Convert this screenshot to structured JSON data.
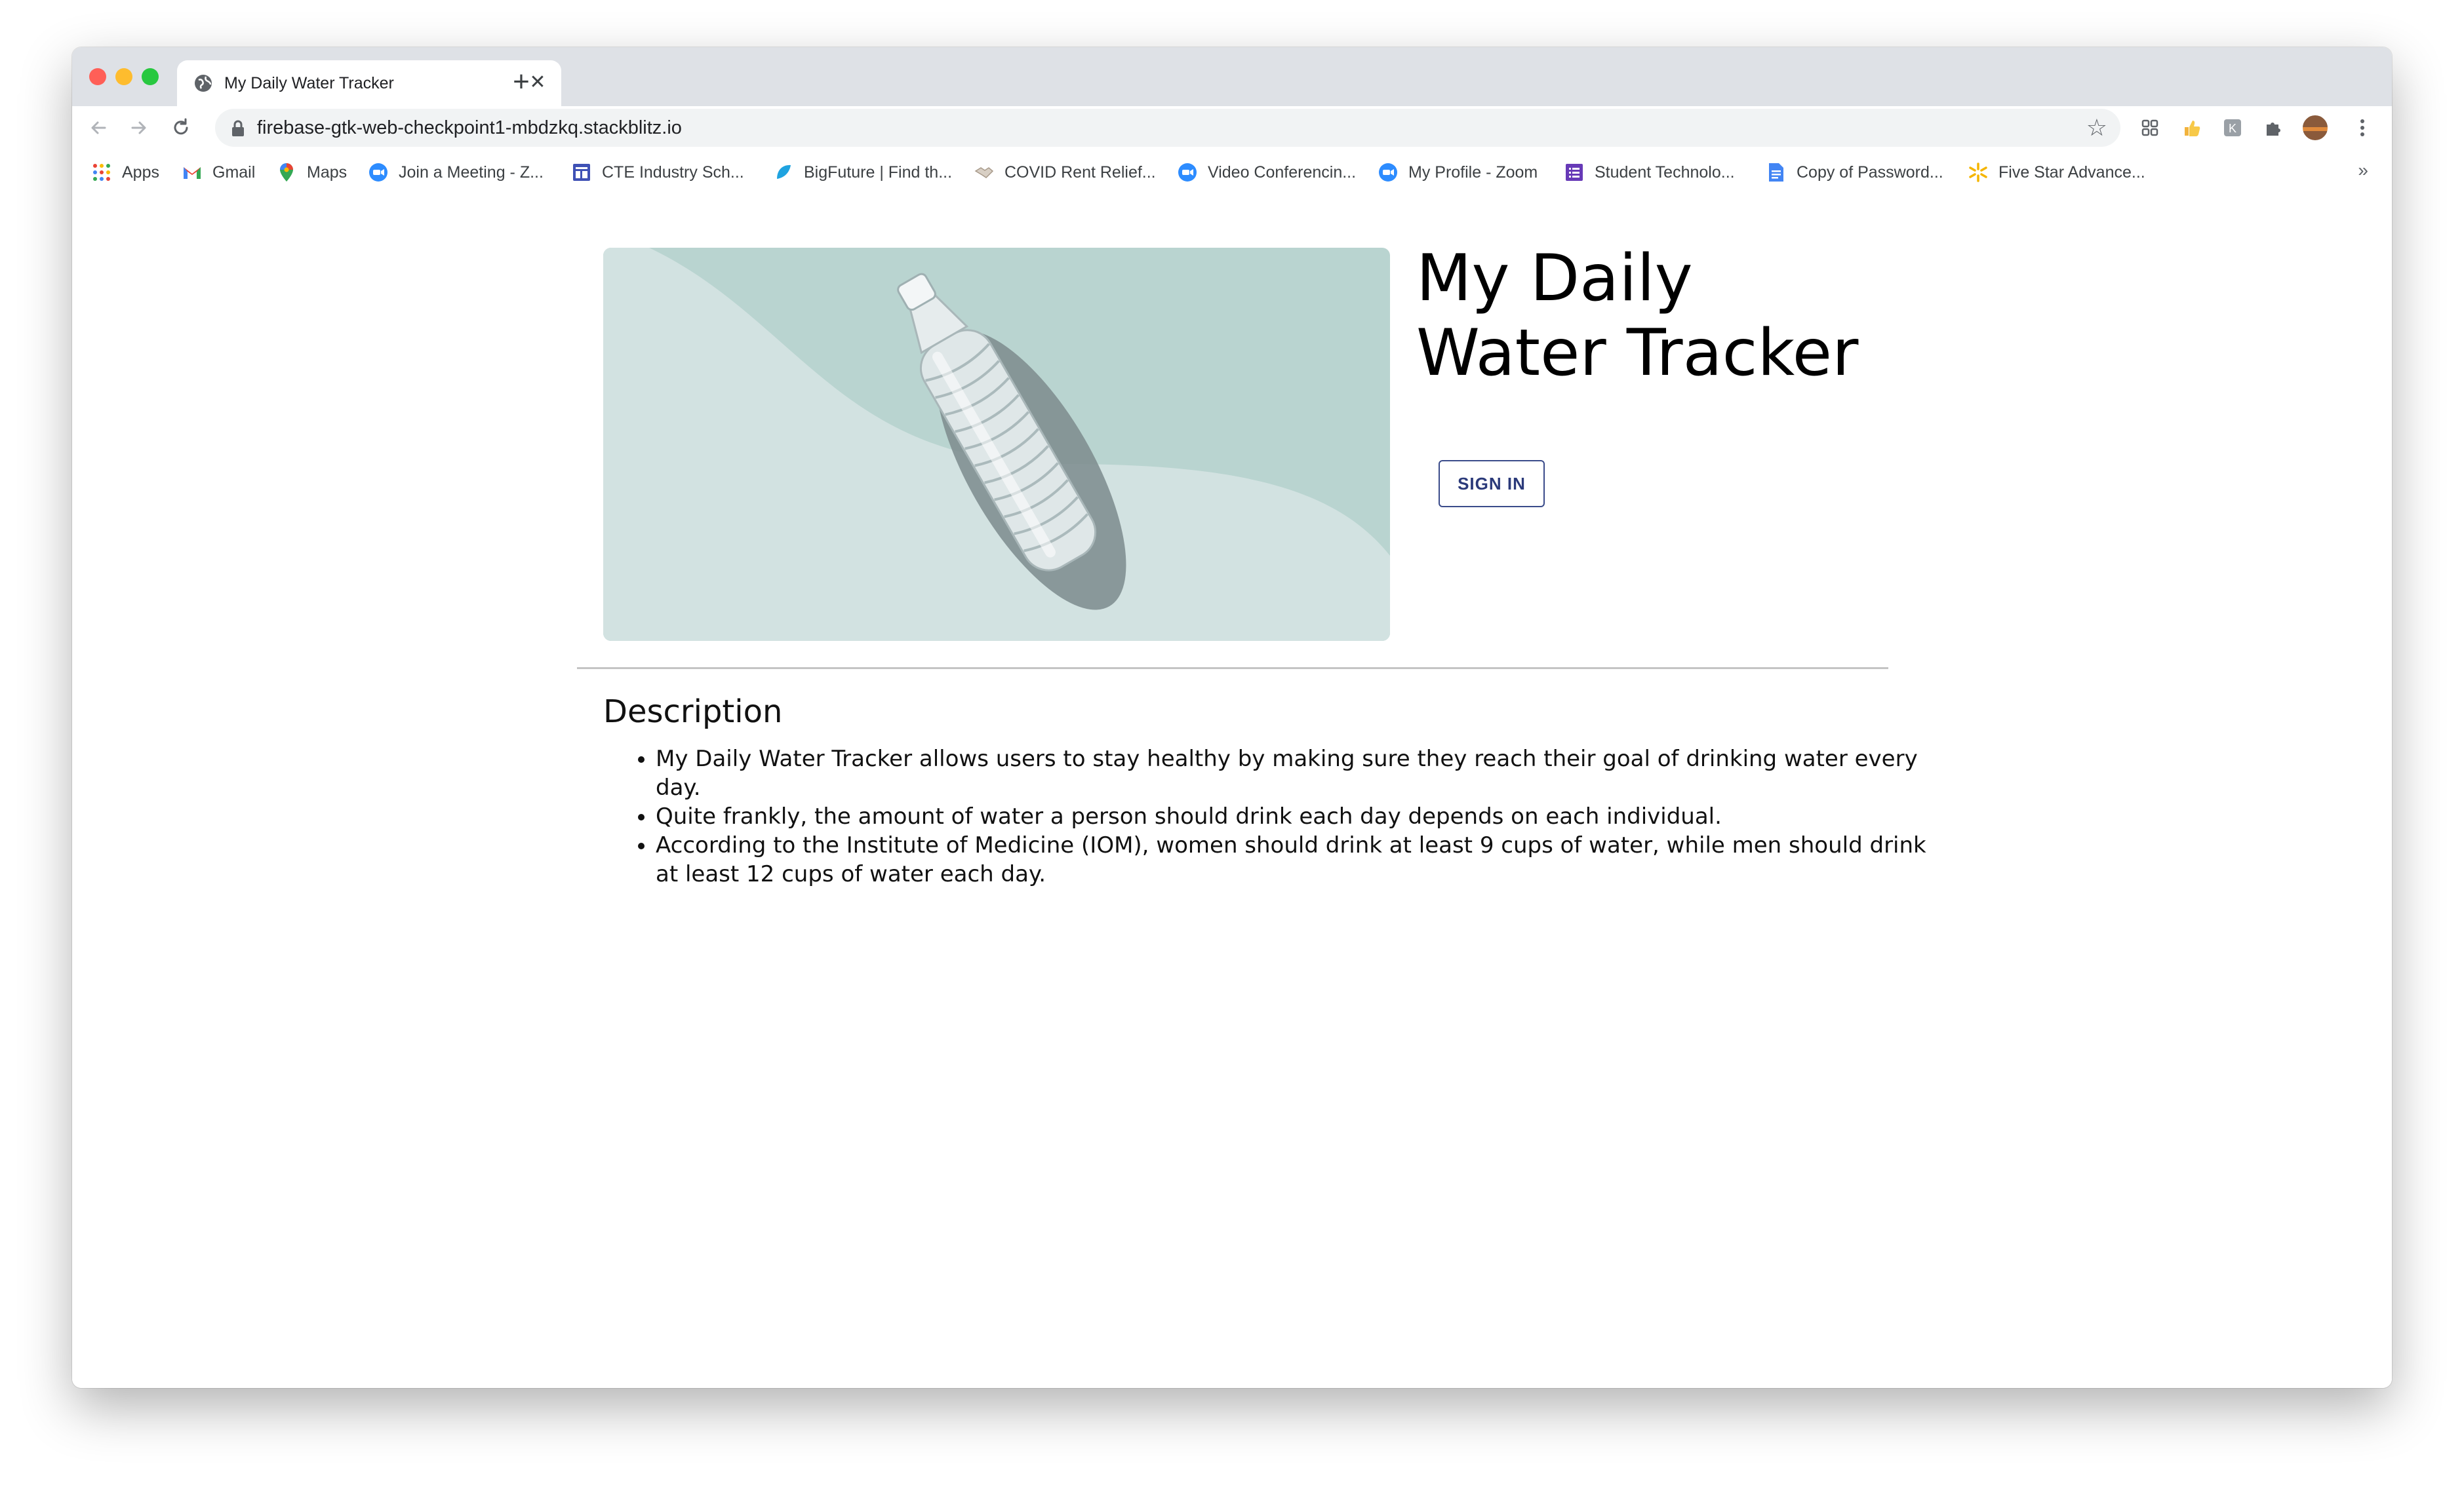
{
  "browser": {
    "tab_title": "My Daily Water Tracker",
    "url": "firebase-gtk-web-checkpoint1-mbdzkq.stackblitz.io",
    "bookmarks": [
      {
        "label": "Apps",
        "icon": "apps-grid-icon"
      },
      {
        "label": "Gmail",
        "icon": "gmail-icon"
      },
      {
        "label": "Maps",
        "icon": "maps-pin-icon"
      },
      {
        "label": "Join a Meeting - Z...",
        "icon": "zoom-icon"
      },
      {
        "label": "CTE Industry Sch...",
        "icon": "forms-icon"
      },
      {
        "label": "BigFuture | Find th...",
        "icon": "bigfuture-icon"
      },
      {
        "label": "COVID Rent Relief...",
        "icon": "handshake-icon"
      },
      {
        "label": "Video Conferencin...",
        "icon": "zoom-icon"
      },
      {
        "label": "My Profile - Zoom",
        "icon": "zoom-icon"
      },
      {
        "label": "Student Technolo...",
        "icon": "forms-icon"
      },
      {
        "label": "Copy of Password...",
        "icon": "docs-icon"
      },
      {
        "label": "Five Star Advance...",
        "icon": "spark-icon"
      }
    ],
    "more_glyph": "»"
  },
  "page": {
    "title": "My Daily Water Tracker",
    "sign_in_label": "SIGN IN",
    "description_heading": "Description",
    "description_items": [
      "My Daily Water Tracker allows users to stay healthy by making sure they reach their goal of drinking water every day.",
      "Quite frankly, the amount of water a person should drink each day depends on each individual.",
      "According to the Institute of Medicine (IOM), women should drink at least 9 cups of water, while men should drink at least 12 cups of water each day."
    ]
  },
  "colors": {
    "tabstrip": "#dee1e6",
    "image_background": "#c8dcda",
    "sign_in_border": "#3a4b8a",
    "divider": "#c4c4c4"
  }
}
